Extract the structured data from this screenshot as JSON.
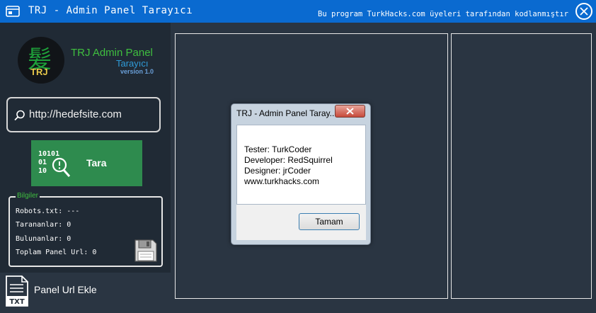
{
  "window": {
    "title": "TRJ - Admin Panel Tarayıcı",
    "subtitle": "Bu program TurkHacks.com üyeleri tarafından kodlanmıştır"
  },
  "logo": {
    "glyph": "髪",
    "badge": "TRJ",
    "name": "TRJ Admin Panel",
    "subname": "Tarayıcı",
    "version": "version 1.0"
  },
  "search": {
    "placeholder": "http://hedefsite.com"
  },
  "scan_button": {
    "label": "Tara"
  },
  "info": {
    "legend": "Bilgiler",
    "robots": "Robots.txt: ---",
    "scanned": "Tarananlar: 0",
    "found": "Bulunanlar: 0",
    "total": "Toplam Panel Url:  0"
  },
  "add_url": {
    "label": "Panel Url Ekle",
    "icon_text": "TXT"
  },
  "dialog": {
    "title": "TRJ - Admin Panel Taray...",
    "lines": [
      "Tester: TurkCoder",
      "Developer: RedSquirrel",
      "Designer: jrCoder",
      "www.turkhacks.com"
    ],
    "ok_label": "Tamam"
  },
  "colors": {
    "titlebar": "#0a6ad0",
    "sidebar": "#202a35",
    "background": "#2a3542",
    "scan_button": "#2e8b4e",
    "legend_text": "#3fbf3f"
  }
}
